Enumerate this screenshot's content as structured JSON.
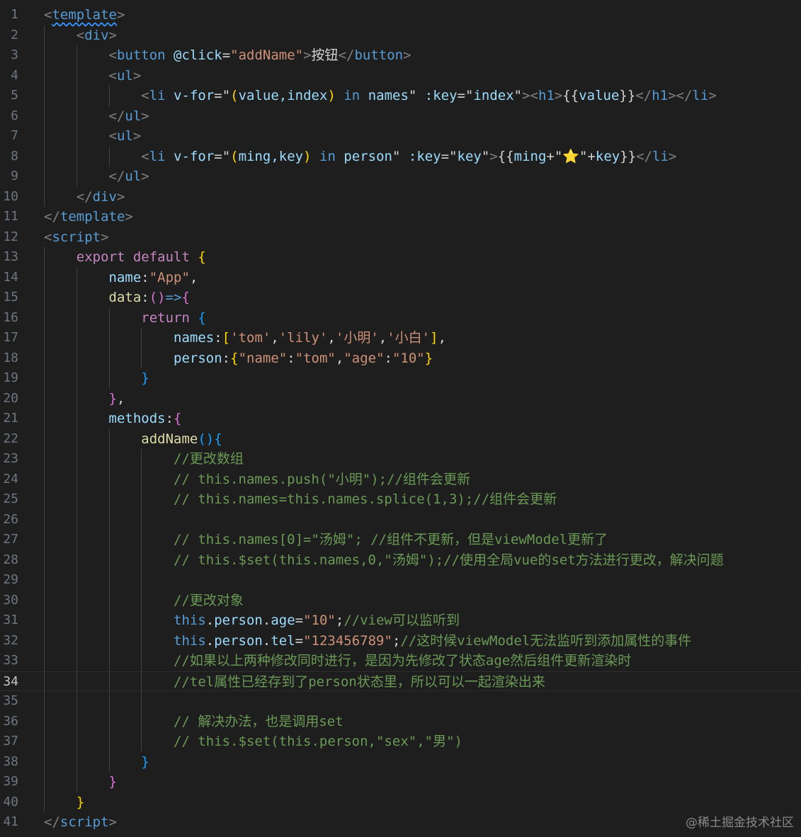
{
  "editor": {
    "language": "vue",
    "current_line": 34,
    "lines": [
      {
        "n": "1",
        "tokens": [
          [
            "<",
            "t-tag"
          ],
          [
            "template",
            "t-tagname t-underline"
          ],
          [
            ">",
            "t-tag"
          ]
        ]
      },
      {
        "n": "2",
        "tokens": [
          [
            "    <",
            "t-tag"
          ],
          [
            "div",
            "t-tagname"
          ],
          [
            ">",
            "t-tag"
          ]
        ]
      },
      {
        "n": "3",
        "tokens": [
          [
            "        <",
            "t-tag"
          ],
          [
            "button",
            "t-tagname"
          ],
          [
            " ",
            "t-pun"
          ],
          [
            "@click",
            "t-attr"
          ],
          [
            "=",
            "t-pun"
          ],
          [
            "\"addName\"",
            "t-str"
          ],
          [
            ">",
            "t-tag"
          ],
          [
            "按钮",
            "t-pun"
          ],
          [
            "</",
            "t-tag"
          ],
          [
            "button",
            "t-tagname"
          ],
          [
            ">",
            "t-tag"
          ]
        ]
      },
      {
        "n": "4",
        "tokens": [
          [
            "        <",
            "t-tag"
          ],
          [
            "ul",
            "t-tagname"
          ],
          [
            ">",
            "t-tag"
          ]
        ]
      },
      {
        "n": "5",
        "tokens": [
          [
            "            <",
            "t-tag"
          ],
          [
            "li",
            "t-tagname"
          ],
          [
            " ",
            "t-pun"
          ],
          [
            "v-for",
            "t-attr"
          ],
          [
            "=\"",
            "t-pun"
          ],
          [
            "(",
            "t-br1"
          ],
          [
            "value,index",
            "t-prop"
          ],
          [
            ")",
            "t-br1"
          ],
          [
            " ",
            "t-pun"
          ],
          [
            "in",
            "t-tagname"
          ],
          [
            " names",
            "t-prop"
          ],
          [
            "\"",
            "t-pun"
          ],
          [
            " :key",
            "t-attr"
          ],
          [
            "=\"",
            "t-pun"
          ],
          [
            "index",
            "t-prop"
          ],
          [
            "\"",
            "t-pun"
          ],
          [
            "><",
            "t-tag"
          ],
          [
            "h1",
            "t-tagname"
          ],
          [
            ">",
            "t-tag"
          ],
          [
            "{{",
            "t-pun"
          ],
          [
            "value",
            "t-prop"
          ],
          [
            "}}",
            "t-pun"
          ],
          [
            "</",
            "t-tag"
          ],
          [
            "h1",
            "t-tagname"
          ],
          [
            "></",
            "t-tag"
          ],
          [
            "li",
            "t-tagname"
          ],
          [
            ">",
            "t-tag"
          ]
        ]
      },
      {
        "n": "6",
        "tokens": [
          [
            "        </",
            "t-tag"
          ],
          [
            "ul",
            "t-tagname"
          ],
          [
            ">",
            "t-tag"
          ]
        ]
      },
      {
        "n": "7",
        "tokens": [
          [
            "        <",
            "t-tag"
          ],
          [
            "ul",
            "t-tagname"
          ],
          [
            ">",
            "t-tag"
          ]
        ]
      },
      {
        "n": "8",
        "tokens": [
          [
            "            <",
            "t-tag"
          ],
          [
            "li",
            "t-tagname"
          ],
          [
            " ",
            "t-pun"
          ],
          [
            "v-for",
            "t-attr"
          ],
          [
            "=\"",
            "t-pun"
          ],
          [
            "(",
            "t-br1"
          ],
          [
            "ming,key",
            "t-prop"
          ],
          [
            ")",
            "t-br1"
          ],
          [
            " ",
            "t-pun"
          ],
          [
            "in",
            "t-tagname"
          ],
          [
            " person",
            "t-prop"
          ],
          [
            "\"",
            "t-pun"
          ],
          [
            " :key",
            "t-attr"
          ],
          [
            "=\"",
            "t-pun"
          ],
          [
            "key",
            "t-prop"
          ],
          [
            "\"",
            "t-pun"
          ],
          [
            ">",
            "t-tag"
          ],
          [
            "{{",
            "t-pun"
          ],
          [
            "ming",
            "t-prop"
          ],
          [
            "+\"",
            "t-pun"
          ],
          [
            "⭐",
            "t-star"
          ],
          [
            "\"+",
            "t-pun"
          ],
          [
            "key",
            "t-prop"
          ],
          [
            "}}",
            "t-pun"
          ],
          [
            "</",
            "t-tag"
          ],
          [
            "li",
            "t-tagname"
          ],
          [
            ">",
            "t-tag"
          ]
        ]
      },
      {
        "n": "9",
        "tokens": [
          [
            "        </",
            "t-tag"
          ],
          [
            "ul",
            "t-tagname"
          ],
          [
            ">",
            "t-tag"
          ]
        ]
      },
      {
        "n": "10",
        "tokens": [
          [
            "    </",
            "t-tag"
          ],
          [
            "div",
            "t-tagname"
          ],
          [
            ">",
            "t-tag"
          ]
        ]
      },
      {
        "n": "11",
        "tokens": [
          [
            "</",
            "t-tag"
          ],
          [
            "template",
            "t-tagname"
          ],
          [
            ">",
            "t-tag"
          ]
        ]
      },
      {
        "n": "12",
        "tokens": [
          [
            "<",
            "t-tag"
          ],
          [
            "script",
            "t-tagname"
          ],
          [
            ">",
            "t-tag"
          ]
        ]
      },
      {
        "n": "13",
        "tokens": [
          [
            "    export default",
            "t-kw"
          ],
          [
            " ",
            "t-pun"
          ],
          [
            "{",
            "t-br1"
          ]
        ]
      },
      {
        "n": "14",
        "tokens": [
          [
            "        name",
            "t-prop"
          ],
          [
            ":",
            "t-pun"
          ],
          [
            "\"App\"",
            "t-str"
          ],
          [
            ",",
            "t-pun"
          ]
        ]
      },
      {
        "n": "15",
        "tokens": [
          [
            "        data",
            "t-fn"
          ],
          [
            ":",
            "t-pun"
          ],
          [
            "()",
            "t-br2"
          ],
          [
            "=>",
            "t-this"
          ],
          [
            "{",
            "t-br2"
          ]
        ]
      },
      {
        "n": "16",
        "tokens": [
          [
            "            return",
            "t-kw"
          ],
          [
            " ",
            "t-pun"
          ],
          [
            "{",
            "t-br3"
          ]
        ]
      },
      {
        "n": "17",
        "tokens": [
          [
            "                names",
            "t-prop"
          ],
          [
            ":",
            "t-pun"
          ],
          [
            "[",
            "t-br1"
          ],
          [
            "'tom'",
            "t-str"
          ],
          [
            ",",
            "t-pun"
          ],
          [
            "'lily'",
            "t-str"
          ],
          [
            ",",
            "t-pun"
          ],
          [
            "'小明'",
            "t-str"
          ],
          [
            ",",
            "t-pun"
          ],
          [
            "'小白'",
            "t-str"
          ],
          [
            "]",
            "t-br1"
          ],
          [
            ",",
            "t-pun"
          ]
        ]
      },
      {
        "n": "18",
        "tokens": [
          [
            "                person",
            "t-prop"
          ],
          [
            ":",
            "t-pun"
          ],
          [
            "{",
            "t-br1"
          ],
          [
            "\"name\"",
            "t-str"
          ],
          [
            ":",
            "t-pun"
          ],
          [
            "\"tom\"",
            "t-str"
          ],
          [
            ",",
            "t-pun"
          ],
          [
            "\"age\"",
            "t-str"
          ],
          [
            ":",
            "t-pun"
          ],
          [
            "\"10\"",
            "t-str"
          ],
          [
            "}",
            "t-br1"
          ]
        ]
      },
      {
        "n": "19",
        "tokens": [
          [
            "            }",
            "t-br3"
          ]
        ]
      },
      {
        "n": "20",
        "tokens": [
          [
            "        }",
            "t-br2"
          ],
          [
            ",",
            "t-pun"
          ]
        ]
      },
      {
        "n": "21",
        "tokens": [
          [
            "        methods",
            "t-prop"
          ],
          [
            ":",
            "t-pun"
          ],
          [
            "{",
            "t-br2"
          ]
        ]
      },
      {
        "n": "22",
        "tokens": [
          [
            "            addName",
            "t-fn"
          ],
          [
            "(){",
            "t-br3"
          ]
        ]
      },
      {
        "n": "23",
        "tokens": [
          [
            "                //更改数组",
            "t-cm"
          ]
        ]
      },
      {
        "n": "24",
        "tokens": [
          [
            "                // this.names.push(\"小明\");//组件会更新",
            "t-cm"
          ]
        ]
      },
      {
        "n": "25",
        "tokens": [
          [
            "                // this.names=this.names.splice(1,3);//组件会更新",
            "t-cm"
          ]
        ]
      },
      {
        "n": "26",
        "tokens": []
      },
      {
        "n": "27",
        "tokens": [
          [
            "                // this.names[0]=\"汤姆\"; //组件不更新，但是viewModel更新了",
            "t-cm"
          ]
        ]
      },
      {
        "n": "28",
        "tokens": [
          [
            "                // this.$set(this.names,0,\"汤姆\");//使用全局vue的set方法进行更改，解决问题",
            "t-cm"
          ]
        ]
      },
      {
        "n": "29",
        "tokens": []
      },
      {
        "n": "30",
        "tokens": [
          [
            "                //更改对象",
            "t-cm"
          ]
        ]
      },
      {
        "n": "31",
        "tokens": [
          [
            "                this",
            "t-this"
          ],
          [
            ".",
            "t-pun"
          ],
          [
            "person",
            "t-prop"
          ],
          [
            ".",
            "t-pun"
          ],
          [
            "age",
            "t-prop"
          ],
          [
            "=",
            "t-pun"
          ],
          [
            "\"10\"",
            "t-str"
          ],
          [
            ";",
            "t-pun"
          ],
          [
            "//view可以监听到",
            "t-cm"
          ]
        ]
      },
      {
        "n": "32",
        "tokens": [
          [
            "                this",
            "t-this"
          ],
          [
            ".",
            "t-pun"
          ],
          [
            "person",
            "t-prop"
          ],
          [
            ".",
            "t-pun"
          ],
          [
            "tel",
            "t-prop"
          ],
          [
            "=",
            "t-pun"
          ],
          [
            "\"123456789\"",
            "t-str"
          ],
          [
            ";",
            "t-pun"
          ],
          [
            "//这时候viewModel无法监听到添加属性的事件",
            "t-cm"
          ]
        ]
      },
      {
        "n": "33",
        "tokens": [
          [
            "                //如果以上两种修改同时进行，是因为先修改了状态age然后组件更新渲染时",
            "t-cm"
          ]
        ]
      },
      {
        "n": "34",
        "tokens": [
          [
            "                //tel属性已经存到了person状态里，所以可以一起渲染出来",
            "t-cm"
          ]
        ]
      },
      {
        "n": "35",
        "tokens": []
      },
      {
        "n": "36",
        "tokens": [
          [
            "                // 解决办法，也是调用set",
            "t-cm"
          ]
        ]
      },
      {
        "n": "37",
        "tokens": [
          [
            "                // this.$set(this.person,\"sex\",\"男\")",
            "t-cm"
          ]
        ]
      },
      {
        "n": "38",
        "tokens": [
          [
            "            }",
            "t-br3"
          ]
        ]
      },
      {
        "n": "39",
        "tokens": [
          [
            "        }",
            "t-br2"
          ]
        ]
      },
      {
        "n": "40",
        "tokens": [
          [
            "    }",
            "t-br1"
          ]
        ]
      },
      {
        "n": "41",
        "tokens": [
          [
            "</",
            "t-tag"
          ],
          [
            "script",
            "t-tagname"
          ],
          [
            ">",
            "t-tag"
          ]
        ]
      }
    ]
  },
  "watermark": "@稀土掘金技术社区"
}
